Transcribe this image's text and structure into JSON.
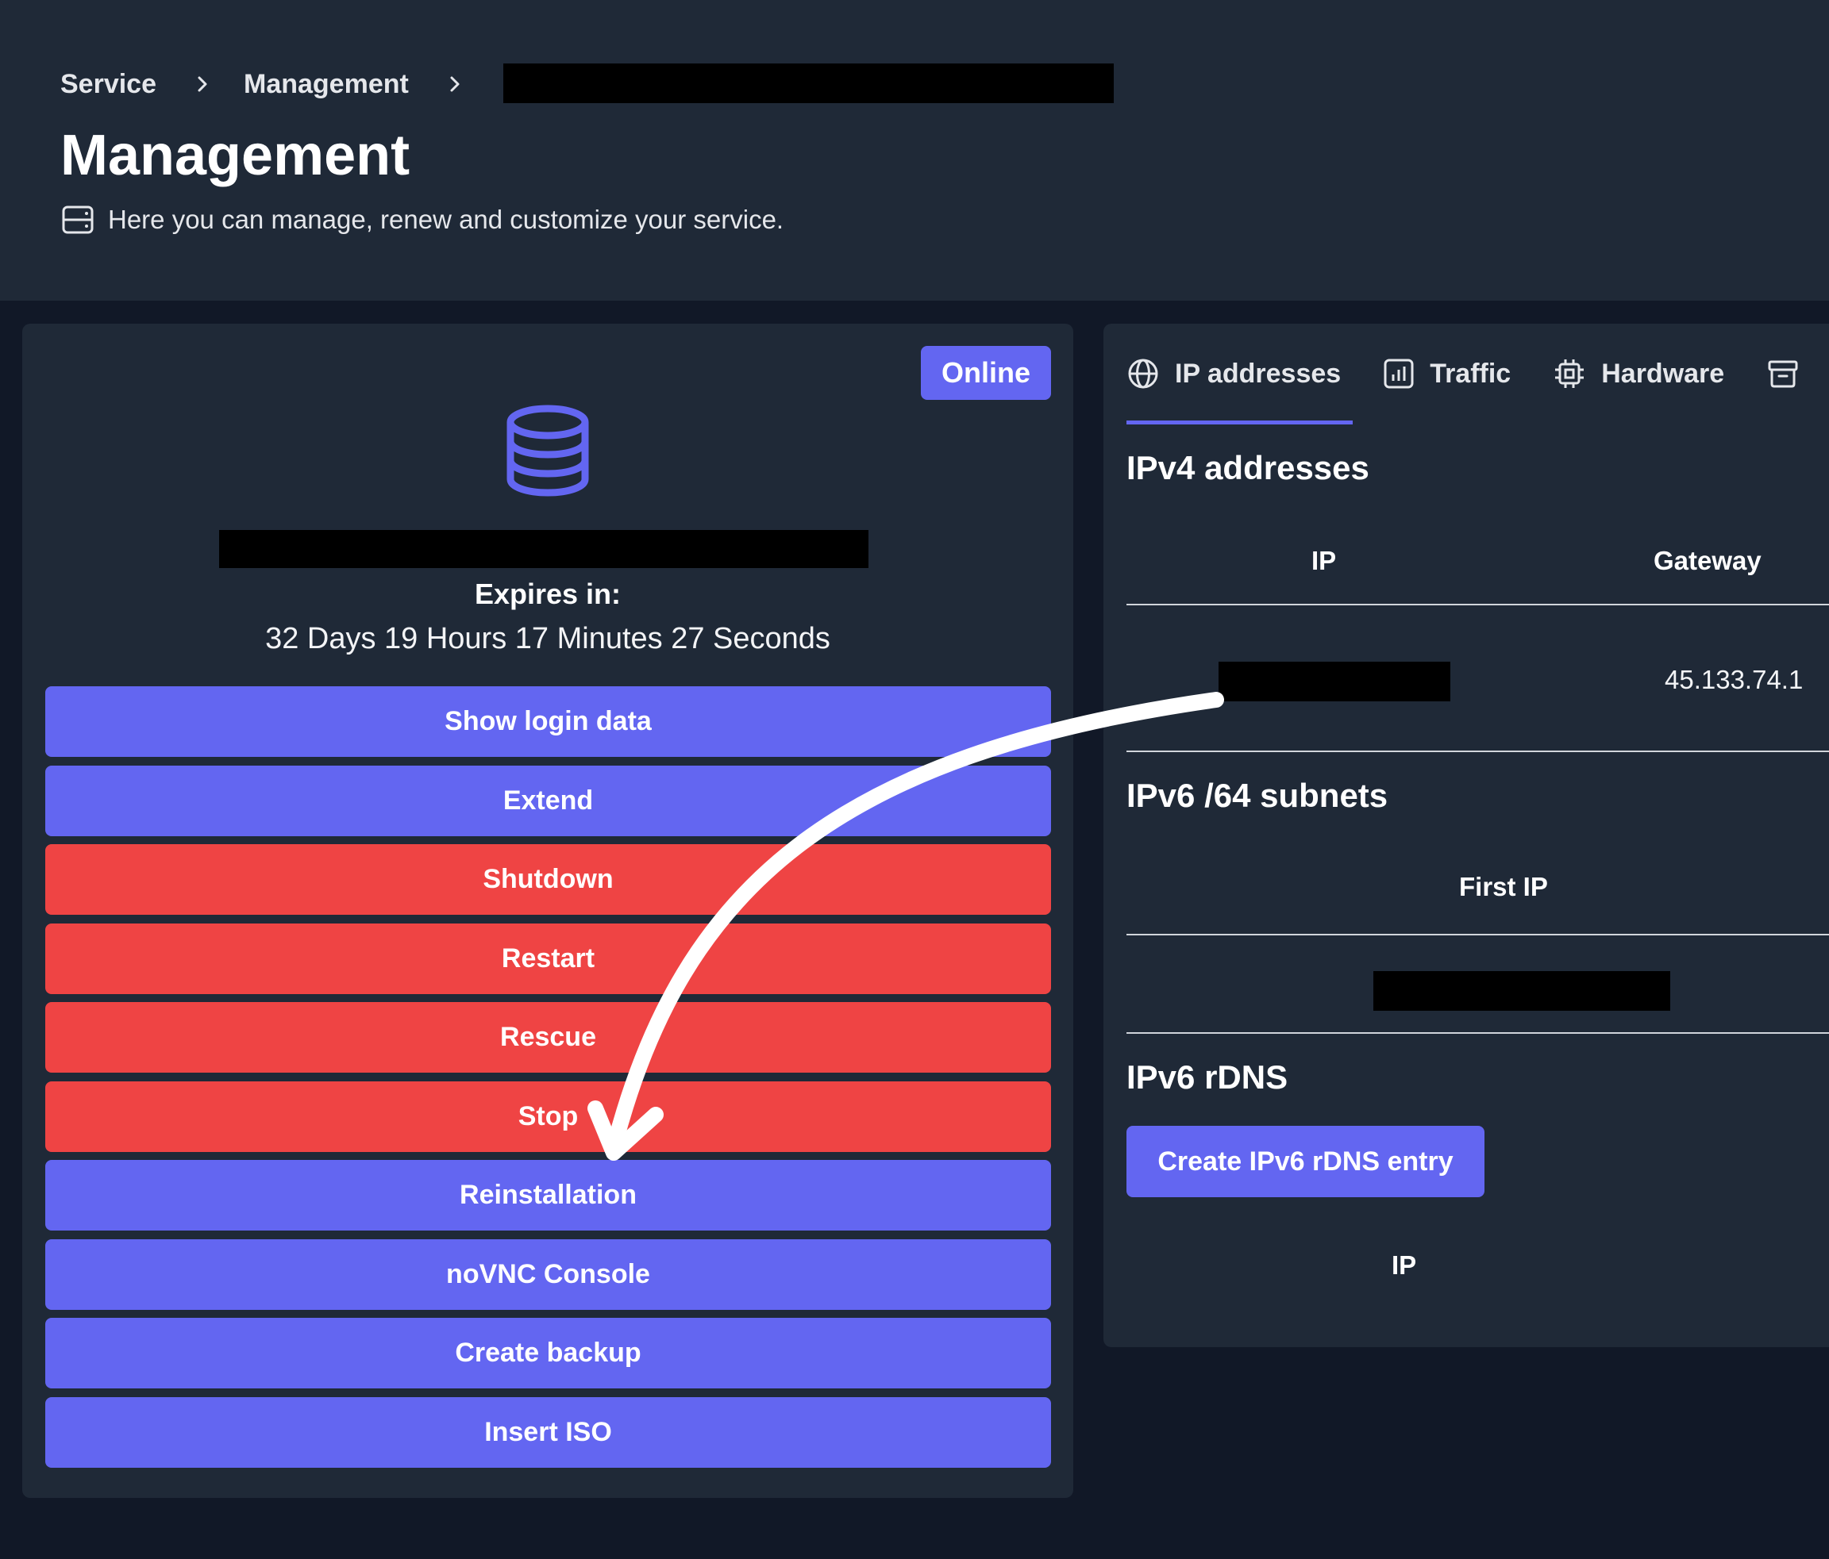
{
  "breadcrumb": {
    "items": [
      "Service",
      "Management"
    ]
  },
  "page": {
    "title": "Management",
    "subtitle": "Here you can manage, renew and customize your service."
  },
  "server": {
    "status": "Online",
    "expires_label": "Expires in:",
    "expires_value": "32 Days 19 Hours 17 Minutes 27 Seconds",
    "icon": "database-icon"
  },
  "actions": [
    {
      "label": "Show login data",
      "variant": "primary"
    },
    {
      "label": "Extend",
      "variant": "primary"
    },
    {
      "label": "Shutdown",
      "variant": "danger"
    },
    {
      "label": "Restart",
      "variant": "danger"
    },
    {
      "label": "Rescue",
      "variant": "danger"
    },
    {
      "label": "Stop",
      "variant": "danger"
    },
    {
      "label": "Reinstallation",
      "variant": "primary"
    },
    {
      "label": "noVNC Console",
      "variant": "primary"
    },
    {
      "label": "Create backup",
      "variant": "primary"
    },
    {
      "label": "Insert ISO",
      "variant": "primary"
    }
  ],
  "tabs": [
    {
      "label": "IP addresses",
      "icon": "globe-icon",
      "active": true
    },
    {
      "label": "Traffic",
      "icon": "bar-chart-icon",
      "active": false
    },
    {
      "label": "Hardware",
      "icon": "cpu-icon",
      "active": false
    },
    {
      "label": "",
      "icon": "archive-icon",
      "active": false
    }
  ],
  "ipv4": {
    "title": "IPv4 addresses",
    "columns": [
      "IP",
      "Gateway"
    ],
    "rows": [
      {
        "ip": "",
        "gateway": "45.133.74.1"
      }
    ]
  },
  "ipv6_subnets": {
    "title": "IPv6 /64 subnets",
    "columns": [
      "First IP"
    ]
  },
  "ipv6_rdns": {
    "title": "IPv6 rDNS",
    "button_label": "Create IPv6 rDNS entry",
    "columns": [
      "IP"
    ]
  },
  "colors": {
    "primary": "#6366f1",
    "danger": "#ef4444",
    "page_bg": "#111827",
    "card_bg": "#1f2937"
  }
}
